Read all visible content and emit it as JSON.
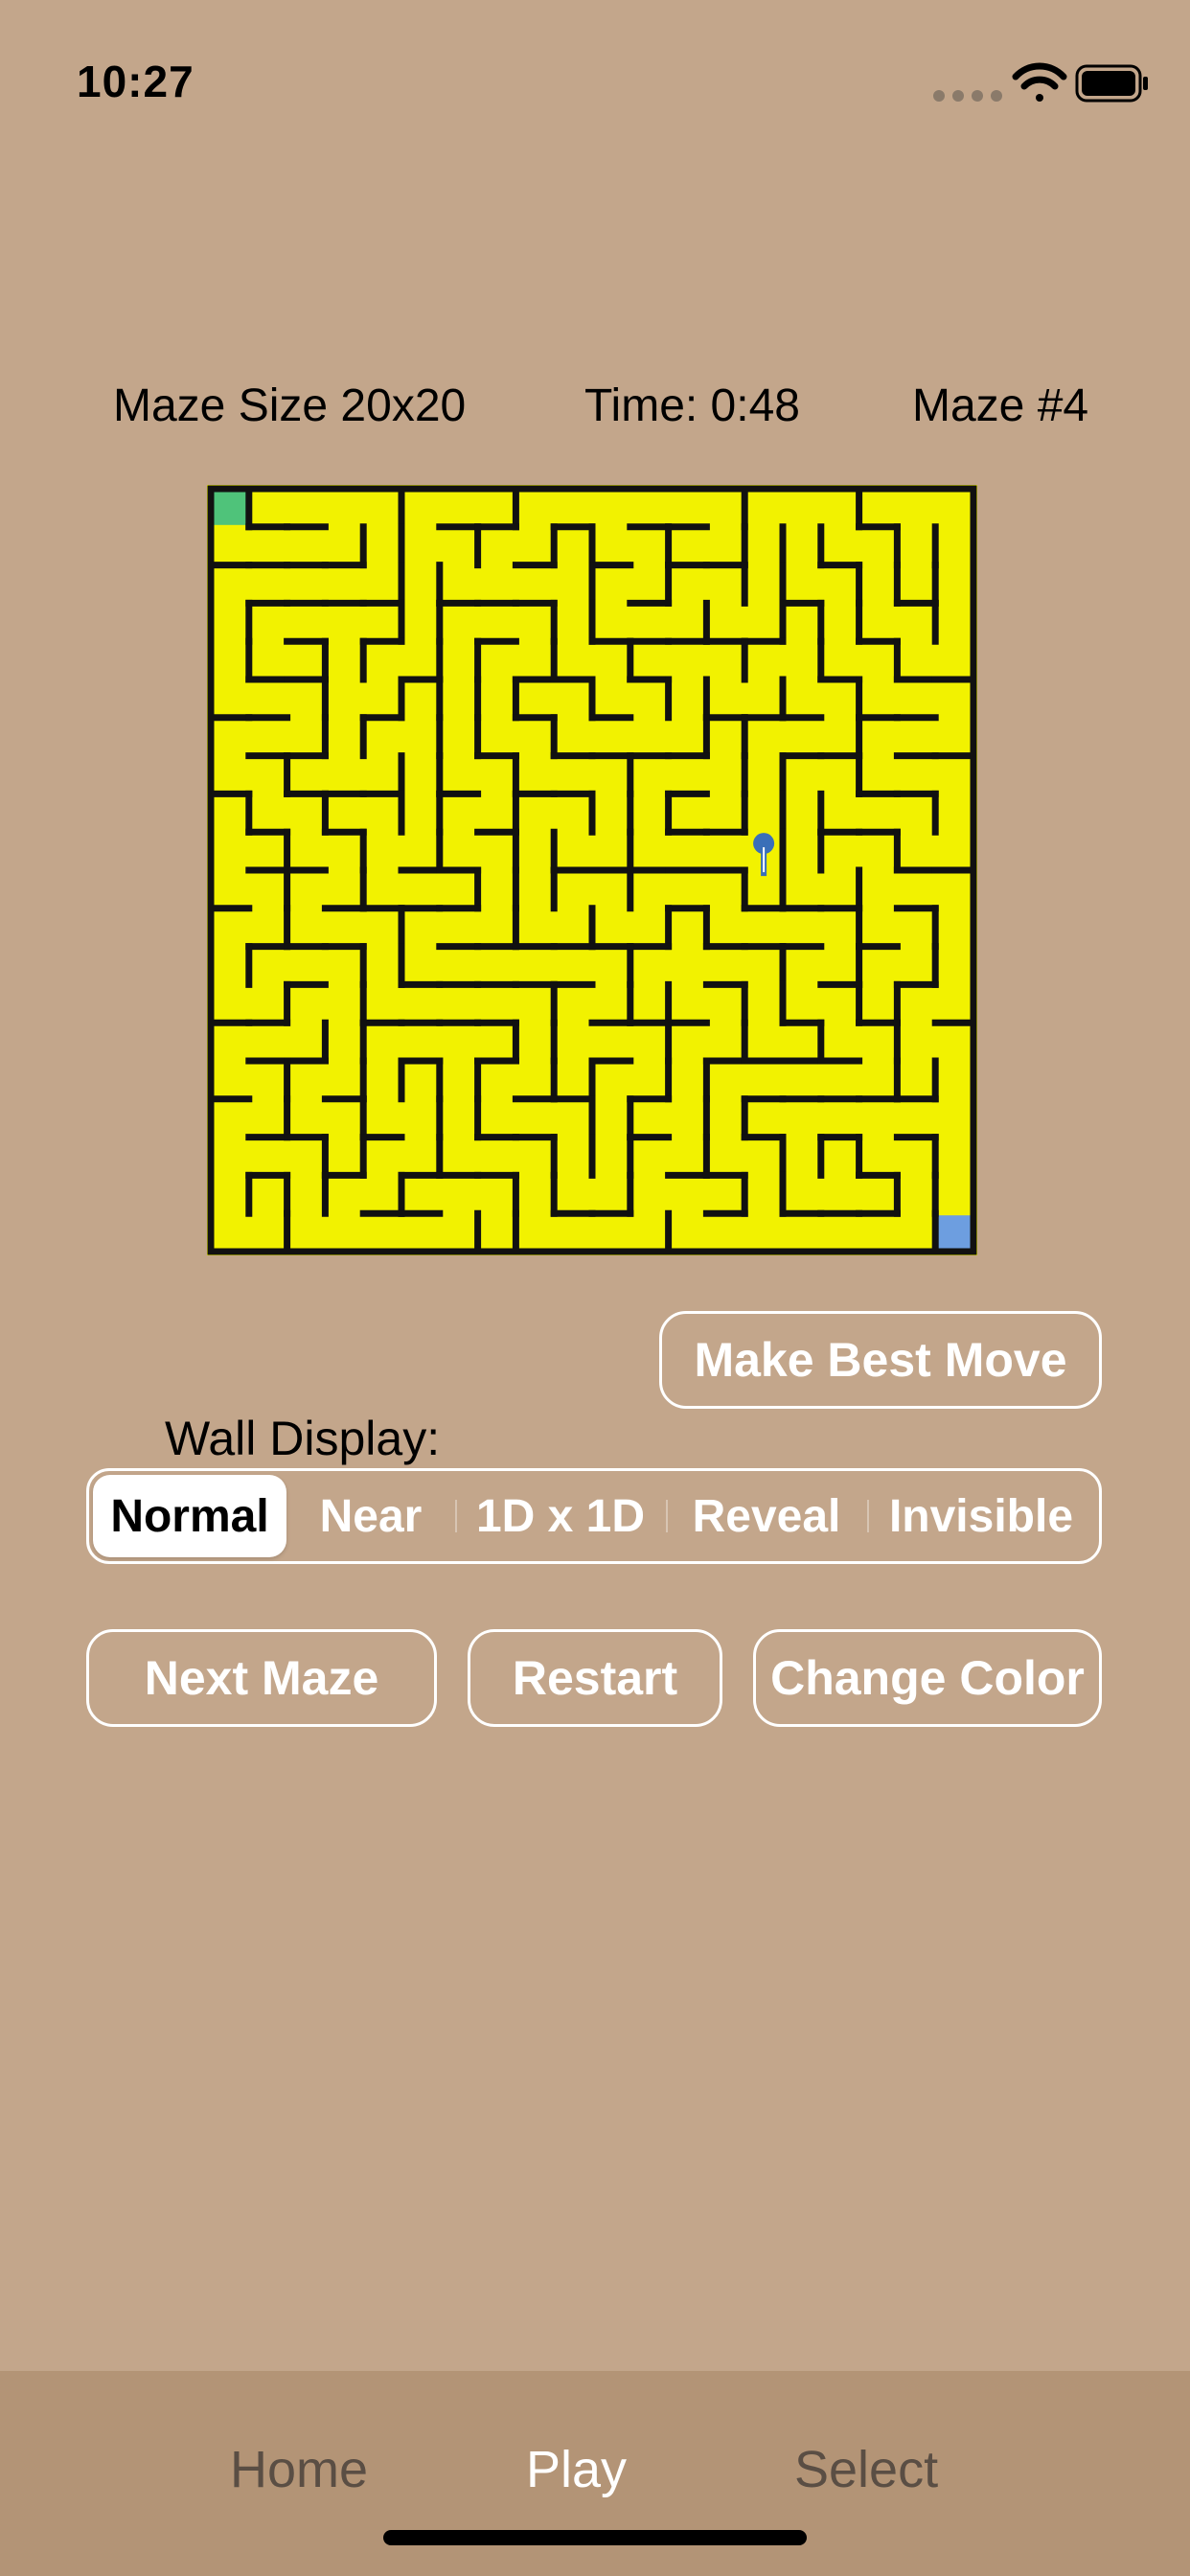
{
  "status_bar": {
    "time": "10:27",
    "icons": [
      "cellular-signal-icon",
      "wifi-icon",
      "battery-icon"
    ]
  },
  "header": {
    "maze_size": "Maze Size 20x20",
    "time": "Time: 0:48",
    "maze_number": "Maze #4"
  },
  "maze": {
    "rows": 20,
    "cols": 20,
    "path_color": "#f2f200",
    "wall_color": "#111111",
    "start_color": "#4fc37a",
    "goal_color": "#6d9ee0",
    "player_color": "#3a6fb8",
    "start_cell": [
      0,
      0
    ],
    "goal_cell": [
      19,
      19
    ],
    "player_cell": [
      9,
      14
    ]
  },
  "controls": {
    "best_move": "Make Best Move",
    "wall_display_label": "Wall Display:",
    "wall_display_options": [
      "Normal",
      "Near",
      "1D x 1D",
      "Reveal",
      "Invisible"
    ],
    "wall_display_selected": "Normal",
    "next_maze": "Next Maze",
    "restart": "Restart",
    "change_color": "Change Color"
  },
  "tabbar": {
    "home": "Home",
    "play": "Play",
    "select": "Select",
    "active": "Play"
  }
}
